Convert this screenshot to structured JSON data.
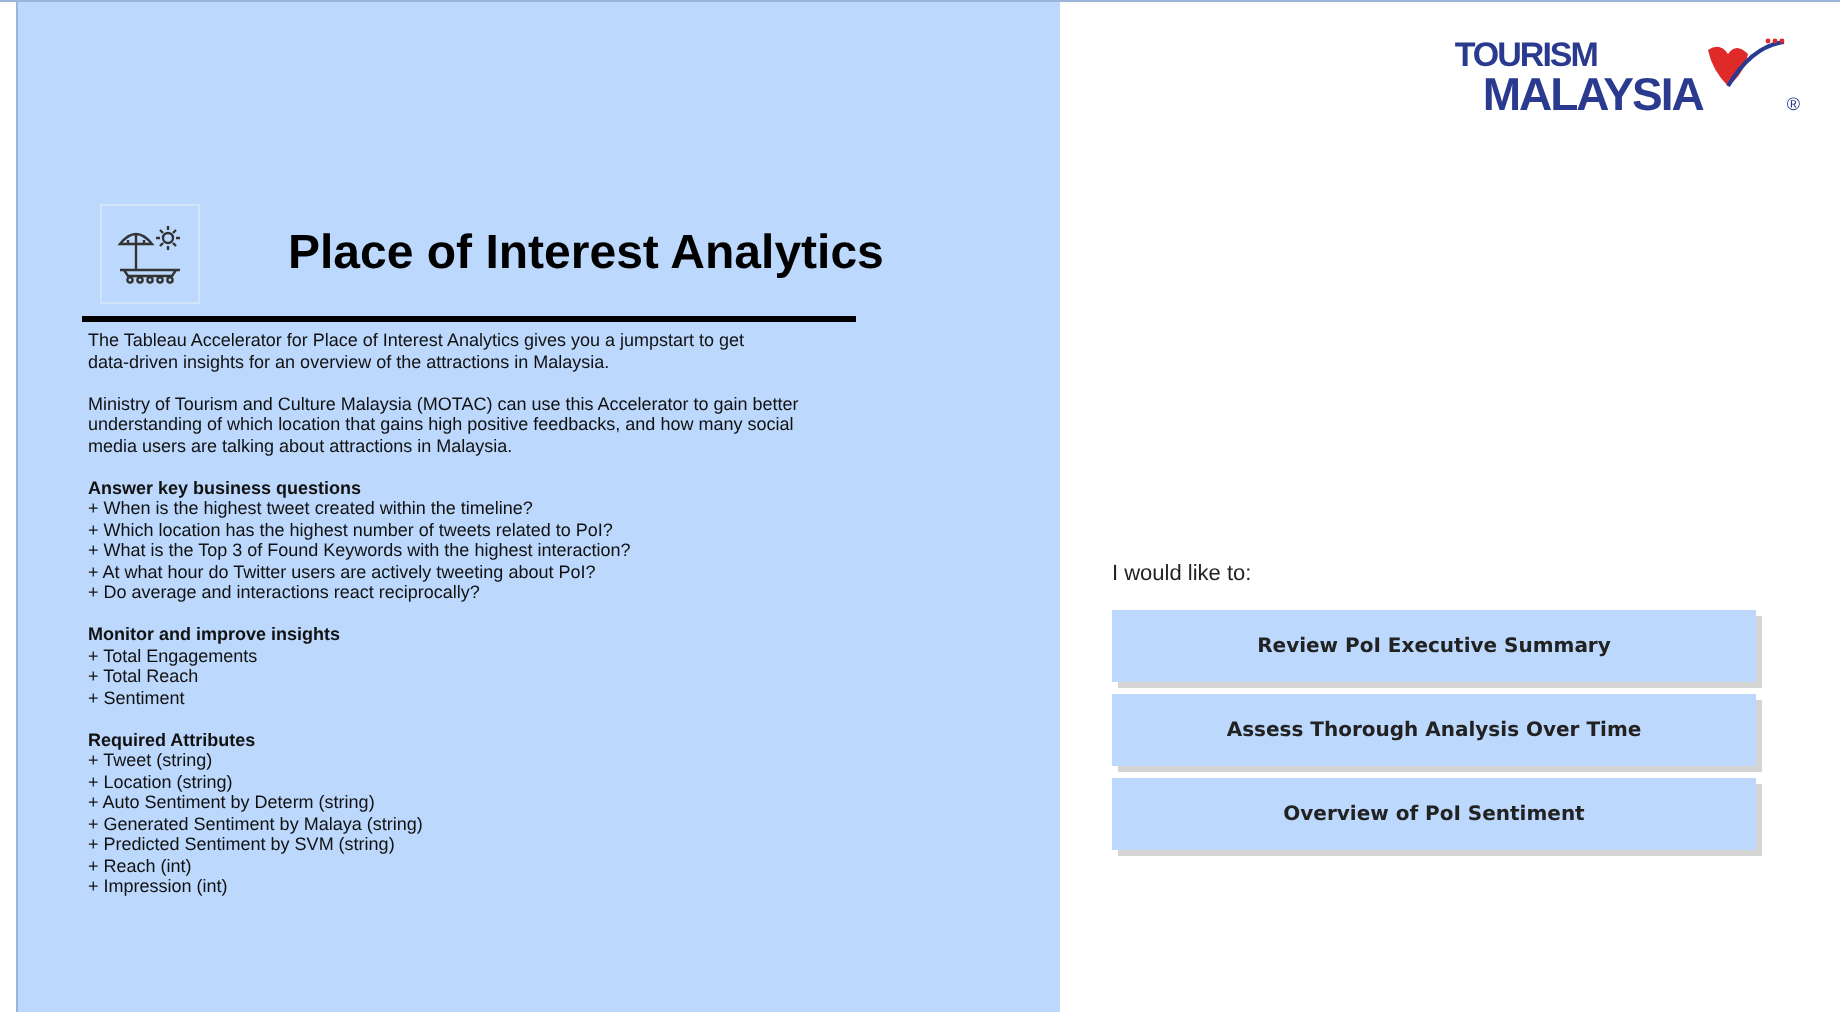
{
  "intro": {
    "title": "Place of Interest Analytics",
    "paragraphs": [
      "The Tableau Accelerator for Place of Interest Analytics gives you a jumpstart to get\ndata-driven insights for an overview of the attractions in Malaysia.",
      "Ministry of Tourism and Culture Malaysia (MOTAC) can use this Accelerator to gain better\nunderstanding of which location that gains high positive feedbacks, and how many social\nmedia users are talking about attractions in Malaysia."
    ],
    "sections": [
      {
        "heading": "Answer key business questions",
        "items": [
          "+ When is the highest tweet created within the timeline?",
          "+ Which location has the highest number of tweets related to PoI?",
          "+ What is the Top 3 of Found Keywords with the highest interaction?",
          "+ At what hour do Twitter users are actively tweeting about PoI?",
          "+ Do average and interactions react reciprocally?"
        ]
      },
      {
        "heading": "Monitor and improve insights",
        "items": [
          "+ Total Engagements",
          "+ Total Reach",
          "+ Sentiment"
        ]
      },
      {
        "heading": "Required Attributes",
        "items": [
          "+ Tweet (string)",
          "+ Location (string)",
          "+ Auto Sentiment by Determ (string)",
          "+ Generated Sentiment by Malaya (string)",
          "+ Predicted Sentiment by SVM (string)",
          "+ Reach (int)",
          "+ Impression (int)"
        ]
      }
    ]
  },
  "logo": {
    "line_1": "TOURISM",
    "line_2": "MALAYSIA",
    "mark": "®"
  },
  "navigation": {
    "prompt": "I would like to:",
    "buttons": [
      "Review PoI Executive Summary",
      "Assess Thorough Analysis Over Time",
      "Overview of PoI Sentiment"
    ]
  }
}
